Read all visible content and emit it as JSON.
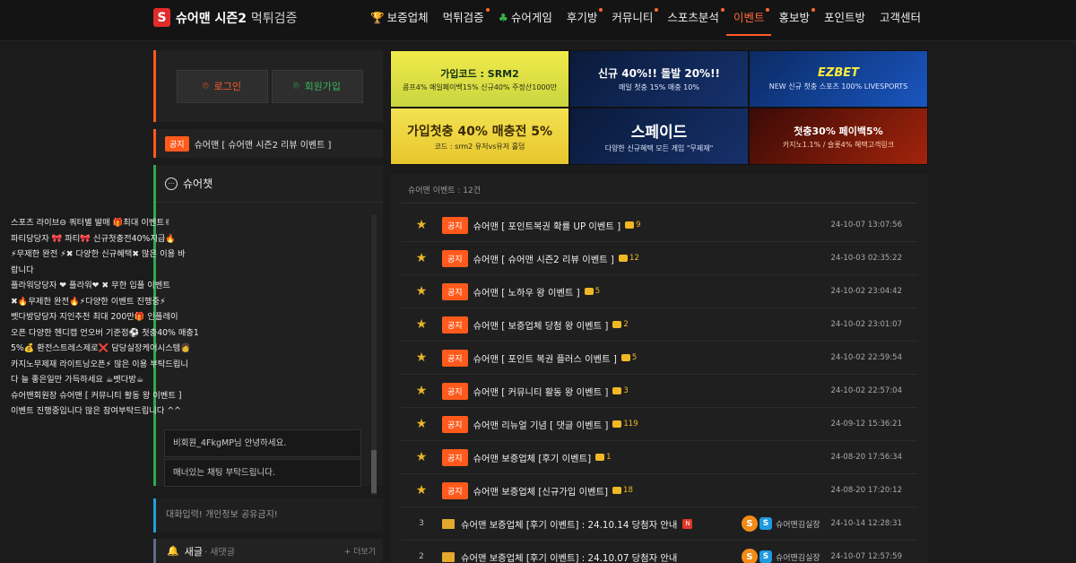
{
  "header": {
    "logo_mark": "S",
    "logo_text": "슈어맨 시즌2",
    "logo_sub": "먹튀검증",
    "nav": [
      {
        "label": "보증업체",
        "icon": "trophy-icon",
        "dot": false,
        "active": false
      },
      {
        "label": "먹튀검증",
        "icon": "",
        "dot": true,
        "active": false
      },
      {
        "label": "슈어게임",
        "icon": "clover-icon",
        "dot": false,
        "active": false
      },
      {
        "label": "후기방",
        "icon": "",
        "dot": true,
        "active": false
      },
      {
        "label": "커뮤니티",
        "icon": "",
        "dot": true,
        "active": false
      },
      {
        "label": "스포츠분석",
        "icon": "",
        "dot": true,
        "active": false
      },
      {
        "label": "이벤트",
        "icon": "",
        "dot": true,
        "active": true
      },
      {
        "label": "홍보방",
        "icon": "",
        "dot": true,
        "active": false
      },
      {
        "label": "포인트방",
        "icon": "",
        "dot": false,
        "active": false
      },
      {
        "label": "고객센터",
        "icon": "",
        "dot": false,
        "active": false
      }
    ]
  },
  "sidebar": {
    "login_label": "로그인",
    "join_label": "회원가입",
    "notice_tag": "공지",
    "notice_text": "슈어맨 [ 슈어맨 시즌2 리뷰 이벤트 ]",
    "chat_title": "슈어챗",
    "chat_lines": [
      "스포츠 라이브⊖ 쿼터별 발매 🎁최대 이벤트✌",
      "파티당당자  🎀 파티🎀  신규첫충전40%지급🔥",
      "⚡무제한 완전 ⚡✖ 다양한 신규혜택✖ 많은 이용 바",
      "랍니다",
      "플라워당당자  ❤ 플라워❤ ✖ 무한 입플 이벤트",
      "✖🔥무제한 완전🔥⚡다양한 이벤트 진행중⚡",
      "벳다방당당자  지인추천 최대 200만🎁 인플레이",
      "오픈 다양한 헨디캡 언오버 기준점⚽ 첫충40% 매충1",
      "5%💰 환전스트레스제로❌ 담당실장케어시스템👩",
      "카지노무제재 라이트닝오픈⚡ 많은 이용 부탁드립니",
      "다 늘 좋은일만 가득하세요 ☕벳다방☕",
      "슈어맨회원장  슈어맨 [ 커뮤니티 활동 왕 이벤트 ]",
      "이벤트 진행중입니다 많은 참여부탁드립니다 ^^"
    ],
    "guest_messages": [
      "비회원_4FkgMP님 안녕하세요.",
      "매너있는 채팅 부탁드립니다."
    ],
    "chat_input_placeholder": "대화입력! 개인정보 공유금지!",
    "new_title": "새글",
    "new_sub": "· 새댓글",
    "new_more": "+ 더보기"
  },
  "banners": [
    {
      "title": "가입코드 : SRM2",
      "sub": "콤프4% 매일페이백15% 신규40% 주정산1000만"
    },
    {
      "title": "신규 40%!! 돌발 20%!!",
      "sub": "매일 첫충 15% 매충 10%"
    },
    {
      "title": "EZBET",
      "sub": "NEW 신규 첫충 스포츠 100% LIVESPORTS"
    },
    {
      "title": "가입첫충 40% 매충전 5%",
      "sub": "코드 : srm2  유저vs유저 홀덤"
    },
    {
      "title": "스페이드",
      "sub": "다양한 신규혜택 모든 게임 \"무제재\""
    },
    {
      "title": "첫충30% 페이백5%",
      "sub": "카지노1.1% / 슬롯4%  혜택고객링크"
    }
  ],
  "board": {
    "count_label": "슈어맨 이벤트 : 12건",
    "rows": [
      {
        "marker": "star",
        "tag": "공지",
        "title": "슈어맨 [ 포인트복권 확률 UP 이벤트 ]",
        "comments": "9",
        "author": "",
        "new": false,
        "date": "24-10-07 13:07:56"
      },
      {
        "marker": "star",
        "tag": "공지",
        "title": "슈어맨 [ 슈어맨 시즌2 리뷰 이벤트 ]",
        "comments": "12",
        "author": "",
        "new": false,
        "date": "24-10-03 02:35:22"
      },
      {
        "marker": "star",
        "tag": "공지",
        "title": "슈어맨 [ 노하우 왕 이벤트 ]",
        "comments": "5",
        "author": "",
        "new": false,
        "date": "24-10-02 23:04:42"
      },
      {
        "marker": "star",
        "tag": "공지",
        "title": "슈어맨 [ 보증업체 당첨 왕 이벤트 ]",
        "comments": "2",
        "author": "",
        "new": false,
        "date": "24-10-02 23:01:07"
      },
      {
        "marker": "star",
        "tag": "공지",
        "title": "슈어맨 [ 포인트 복권 플러스 이벤트 ]",
        "comments": "5",
        "author": "",
        "new": false,
        "date": "24-10-02 22:59:54"
      },
      {
        "marker": "star",
        "tag": "공지",
        "title": "슈어맨 [ 커뮤니티 활동 왕 이벤트 ]",
        "comments": "3",
        "author": "",
        "new": false,
        "date": "24-10-02 22:57:04"
      },
      {
        "marker": "star",
        "tag": "공지",
        "title": "슈어맨 리뉴얼 기념 [ 댓글 이벤트 ]",
        "comments": "119",
        "author": "",
        "new": false,
        "date": "24-09-12 15:36:21"
      },
      {
        "marker": "star",
        "tag": "공지",
        "title": "슈어맨 보증업체 [후기 이벤트]",
        "comments": "1",
        "author": "",
        "new": false,
        "date": "24-08-20 17:56:34"
      },
      {
        "marker": "star",
        "tag": "공지",
        "title": "슈어맨 보증업체 [신규가입 이벤트]",
        "comments": "18",
        "author": "",
        "new": false,
        "date": "24-08-20 17:20:12"
      },
      {
        "marker": "3",
        "tag": "",
        "title": "슈어맨 보증업체 [후기 이벤트] : 24.10.14 당첨자 안내",
        "comments": "",
        "author": "슈어맨김실장",
        "new": true,
        "date": "24-10-14 12:28:31"
      },
      {
        "marker": "2",
        "tag": "",
        "title": "슈어맨 보증업체 [후기 이벤트] : 24.10.07 당첨자 안내",
        "comments": "",
        "author": "슈어맨김실장",
        "new": false,
        "date": "24-10-07 12:57:59"
      }
    ]
  },
  "colors": {
    "accent": "#ff5a1c",
    "chat_border": "#2fa84f",
    "input_border": "#1fa0d8",
    "comment": "#f0b824"
  }
}
